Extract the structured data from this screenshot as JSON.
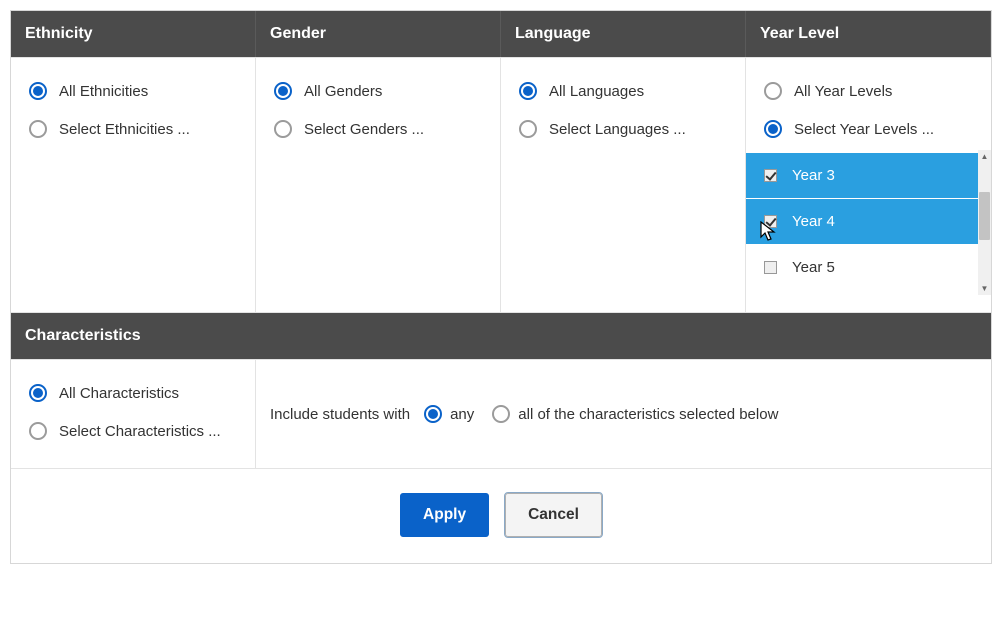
{
  "filters": {
    "ethnicity": {
      "title": "Ethnicity",
      "all_label": "All Ethnicities",
      "select_label": "Select Ethnicities ...",
      "selected": "all"
    },
    "gender": {
      "title": "Gender",
      "all_label": "All Genders",
      "select_label": "Select Genders ...",
      "selected": "all"
    },
    "language": {
      "title": "Language",
      "all_label": "All Languages",
      "select_label": "Select Languages ...",
      "selected": "all"
    },
    "year_level": {
      "title": "Year Level",
      "all_label": "All Year Levels",
      "select_label": "Select Year Levels ...",
      "selected": "select",
      "options": [
        {
          "label": "Year 3",
          "checked": true
        },
        {
          "label": "Year 4",
          "checked": true
        },
        {
          "label": "Year 5",
          "checked": false
        }
      ]
    }
  },
  "characteristics": {
    "title": "Characteristics",
    "all_label": "All Characteristics",
    "select_label": "Select Characteristics ...",
    "selected": "all",
    "include_text_prefix": "Include students with",
    "mode_any_label": "any",
    "mode_all_label": "all of the characteristics selected below",
    "mode_selected": "any"
  },
  "footer": {
    "apply_label": "Apply",
    "cancel_label": "Cancel"
  }
}
